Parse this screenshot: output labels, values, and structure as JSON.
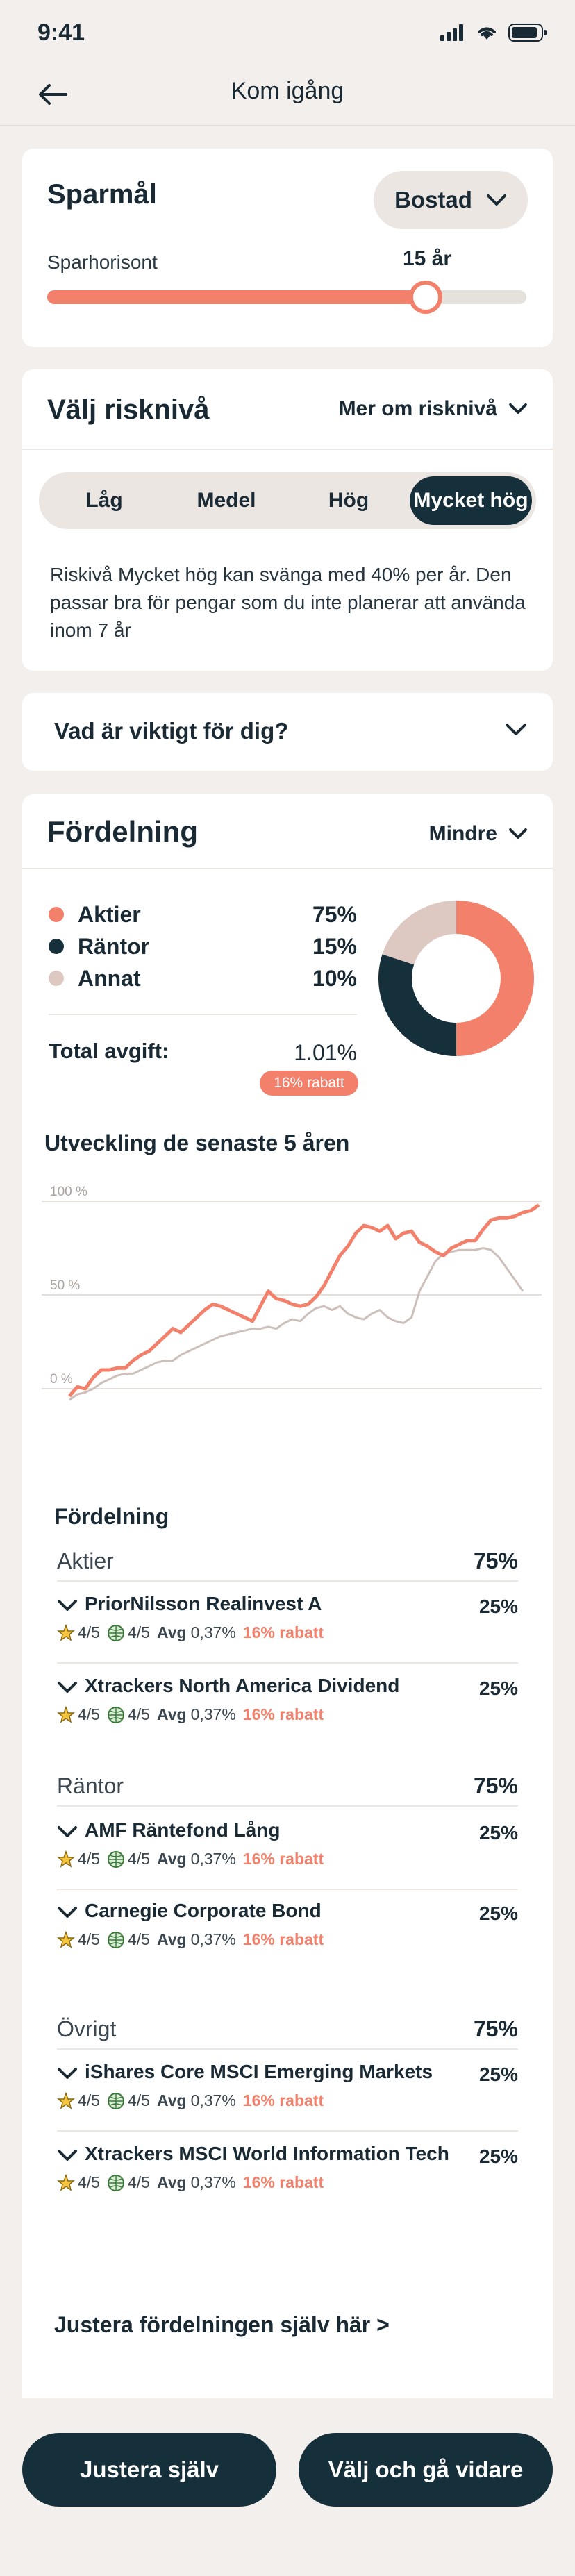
{
  "status_bar": {
    "time": "9:41"
  },
  "header": {
    "title": "Kom igång"
  },
  "goal": {
    "title": "Sparmål",
    "selected": "Bostad",
    "horizon_label": "Sparhorisont",
    "horizon_value": "15 år",
    "horizon_fraction": 0.79
  },
  "risk": {
    "title": "Välj risknivå",
    "more_label": "Mer om risknivå",
    "options": [
      "Låg",
      "Medel",
      "Hög",
      "Mycket hög"
    ],
    "selected_index": 3,
    "description": "Riskivå Mycket hög kan svänga med 40% per år. Den passar bra för pengar som du inte planerar att använda inom 7 år"
  },
  "important": {
    "title": "Vad är viktigt för dig?"
  },
  "allocation": {
    "title": "Fördelning",
    "toggle_label": "Mindre",
    "legend": [
      {
        "label": "Aktier",
        "value": "75%",
        "pct": 50,
        "color": "#f3806b"
      },
      {
        "label": "Räntor",
        "value": "15%",
        "pct": 30,
        "color": "#16303b"
      },
      {
        "label": "Annat",
        "value": "10%",
        "pct": 20,
        "color": "#ddc9c1"
      }
    ],
    "fee_label": "Total avgift:",
    "fee_value": "1.01%",
    "fee_badge": "16% rabatt"
  },
  "chart_data": {
    "type": "line",
    "title": "Utveckling de senaste 5 åren",
    "ylim": [
      0,
      100
    ],
    "yticks": [
      "0 %",
      "50 %",
      "100 %"
    ],
    "grid": true,
    "x": [
      0,
      1,
      2,
      3,
      4,
      5,
      6,
      7,
      8,
      9,
      10,
      11,
      12,
      13,
      14,
      15,
      16,
      17,
      18,
      19,
      20,
      21,
      22,
      23,
      24,
      25,
      26,
      27,
      28,
      29,
      30,
      31,
      32,
      33,
      34,
      35,
      36,
      37,
      38,
      39,
      40,
      41,
      42,
      43,
      44,
      45,
      46,
      47,
      48,
      49,
      50,
      51,
      52,
      53,
      54,
      55,
      56,
      57,
      58,
      59
    ],
    "series": [
      {
        "color": "#f3806b",
        "values": [
          -4,
          1,
          0,
          6,
          10,
          10,
          11,
          11,
          15,
          18,
          20,
          24,
          28,
          32,
          30,
          34,
          38,
          42,
          45,
          44,
          42,
          40,
          38,
          36,
          44,
          52,
          48,
          47,
          45,
          44,
          45,
          49,
          55,
          63,
          71,
          76,
          83,
          87,
          86,
          84,
          87,
          80,
          83,
          84,
          78,
          76,
          73,
          71,
          75,
          77,
          79,
          79,
          85,
          90,
          91,
          91,
          92,
          94,
          95,
          98
        ]
      },
      {
        "color": "#cdbfba",
        "values": [
          -6,
          -3,
          -2,
          0,
          3,
          5,
          7,
          8,
          8,
          10,
          12,
          14,
          15,
          15,
          18,
          20,
          22,
          24,
          26,
          28,
          29,
          30,
          31,
          32,
          32,
          33,
          32,
          35,
          37,
          36,
          40,
          43,
          44,
          42,
          44,
          40,
          38,
          37,
          40,
          42,
          38,
          36,
          35,
          38,
          52,
          60,
          68,
          72,
          73,
          74,
          74,
          74,
          75,
          74,
          70,
          64,
          58,
          52
        ]
      }
    ]
  },
  "breakdown": {
    "title": "Fördelning",
    "groups": [
      {
        "name": "Aktier",
        "pct": "75%",
        "funds": [
          {
            "name": "PriorNilsson Realinvest A",
            "pct": "25%",
            "rating": "4/5",
            "sustain": "4/5",
            "avg_label": "Avg",
            "avg": "0,37%",
            "discount": "16% rabatt"
          },
          {
            "name": "Xtrackers North America Dividend",
            "pct": "25%",
            "rating": "4/5",
            "sustain": "4/5",
            "avg_label": "Avg",
            "avg": "0,37%",
            "discount": "16% rabatt"
          }
        ]
      },
      {
        "name": "Räntor",
        "pct": "75%",
        "funds": [
          {
            "name": "AMF Räntefond Lång",
            "pct": "25%",
            "rating": "4/5",
            "sustain": "4/5",
            "avg_label": "Avg",
            "avg": "0,37%",
            "discount": "16% rabatt"
          },
          {
            "name": "Carnegie Corporate Bond",
            "pct": "25%",
            "rating": "4/5",
            "sustain": "4/5",
            "avg_label": "Avg",
            "avg": "0,37%",
            "discount": "16% rabatt"
          }
        ]
      },
      {
        "name": "Övrigt",
        "pct": "75%",
        "funds": [
          {
            "name": "iShares Core MSCI Emerging Markets",
            "pct": "25%",
            "rating": "4/5",
            "sustain": "4/5",
            "avg_label": "Avg",
            "avg": "0,37%",
            "discount": "16% rabatt"
          },
          {
            "name": "Xtrackers MSCI World Information Tech",
            "pct": "25%",
            "rating": "4/5",
            "sustain": "4/5",
            "avg_label": "Avg",
            "avg": "0,37%",
            "discount": "16% rabatt"
          }
        ]
      }
    ],
    "adjust_link": "Justera fördelningen själv här >"
  },
  "footer": {
    "adjust_button": "Justera själv",
    "continue_button": "Välj och gå vidare"
  }
}
